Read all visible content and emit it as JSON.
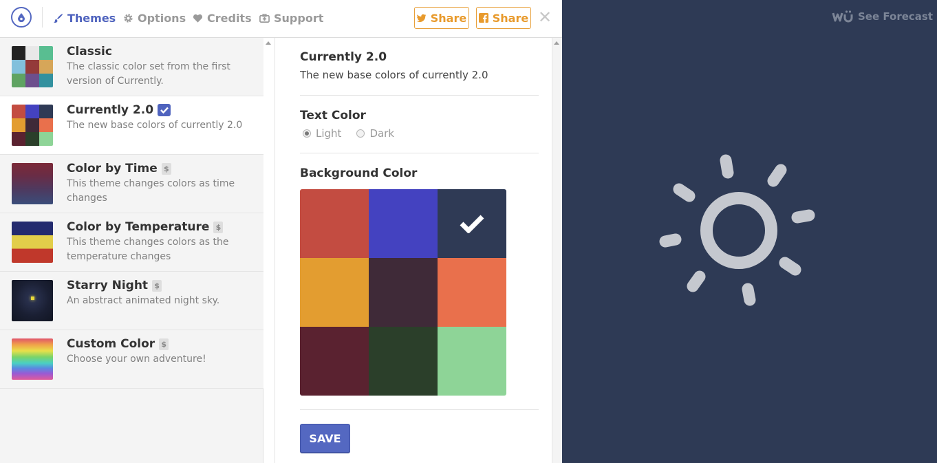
{
  "nav": {
    "themes": "Themes",
    "options": "Options",
    "credits": "Credits",
    "support": "Support",
    "share_twitter": "Share",
    "share_facebook": "Share",
    "close": "✕"
  },
  "themes": [
    {
      "title": "Classic",
      "desc": "The classic color set from the first version of Currently.",
      "colors": [
        "#222222",
        "#e8e8e8",
        "#59be91",
        "#82c0dc",
        "#943a3a",
        "#d6a659",
        "#5fa362",
        "#6d4f8d",
        "#33919f"
      ]
    },
    {
      "title": "Currently 2.0",
      "desc": "The new base colors of currently 2.0",
      "colors": [
        "#c34c41",
        "#4442c0",
        "#2f3a55",
        "#e39d30",
        "#3f2a38",
        "#e9704c",
        "#5a2230",
        "#2b3f2a",
        "#8ed497"
      ]
    },
    {
      "title": "Color by Time",
      "badge": "$",
      "desc": "This theme changes colors as time changes"
    },
    {
      "title": "Color by Temperature",
      "badge": "$",
      "desc": "This theme changes colors as the temperature changes"
    },
    {
      "title": "Starry Night",
      "badge": "$",
      "desc": "An abstract animated night sky."
    },
    {
      "title": "Custom Color",
      "badge": "$",
      "desc": "Choose your own adventure!"
    }
  ],
  "details": {
    "title": "Currently 2.0",
    "desc": "The new base colors of currently 2.0",
    "text_color_title": "Text Color",
    "text_color_options": [
      "Light",
      "Dark"
    ],
    "text_color_selected": "Light",
    "background_color_title": "Background Color",
    "background_colors": [
      "#c34c41",
      "#4442c0",
      "#2f3a55",
      "#e39d30",
      "#3f2a38",
      "#e9704c",
      "#5a2230",
      "#2b3f2a",
      "#8ed497"
    ],
    "background_selected_index": 2,
    "save": "SAVE"
  },
  "preview": {
    "forecast_link": "See Forecast",
    "weather_icon": "sun-icon",
    "background": "#2e3a55"
  },
  "colors": {
    "accent": "#4f63be",
    "share": "#e89a2c"
  }
}
